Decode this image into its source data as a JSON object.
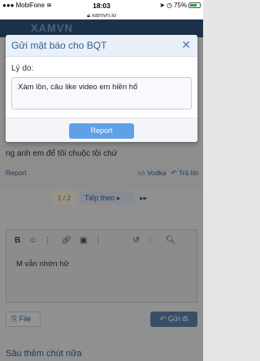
{
  "status_bar": {
    "carrier": "MobiFone",
    "time": "18:03",
    "battery": "75%",
    "battery_level": 0.75
  },
  "browser": {
    "url": "xamvn.io"
  },
  "site": {
    "logo_text": "XAMVN"
  },
  "thread": {
    "message_text": "ng anh em để tôi chuộc tội chứ",
    "report_link": "Report",
    "reaction_user": "Vodka",
    "reply_label": "Trả lời"
  },
  "pager": {
    "current": "1 / 2",
    "next": "Tiếp theo"
  },
  "editor": {
    "content": "M vẫn nhờn hử"
  },
  "composer": {
    "file_label": "File",
    "send_label": "Gửi đi"
  },
  "section": {
    "title": "Sâu thêm chút nữa"
  },
  "dialog": {
    "title": "Gửi mật báo cho BQT",
    "reason_label": "Lý do:",
    "reason_value": "Xàm lồn, câu like video em hiền hổ",
    "submit_label": "Report"
  },
  "colors": {
    "header": "#1e3f66",
    "accent": "#5fa0e8",
    "link": "#1e4f80"
  }
}
